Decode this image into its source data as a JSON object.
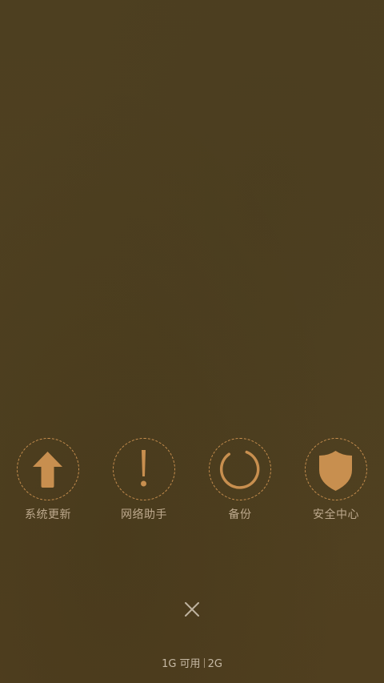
{
  "tools": [
    {
      "label": "系统更新",
      "icon": "arrow-up-icon"
    },
    {
      "label": "网络助手",
      "icon": "exclamation-icon"
    },
    {
      "label": "备份",
      "icon": "refresh-arc-icon"
    },
    {
      "label": "安全中心",
      "icon": "shield-icon"
    }
  ],
  "memory": {
    "available": "1G 可用",
    "total": "2G"
  },
  "colors": {
    "background": "#4f4021",
    "accent": "#c88f4f",
    "label": "#bda98d"
  }
}
